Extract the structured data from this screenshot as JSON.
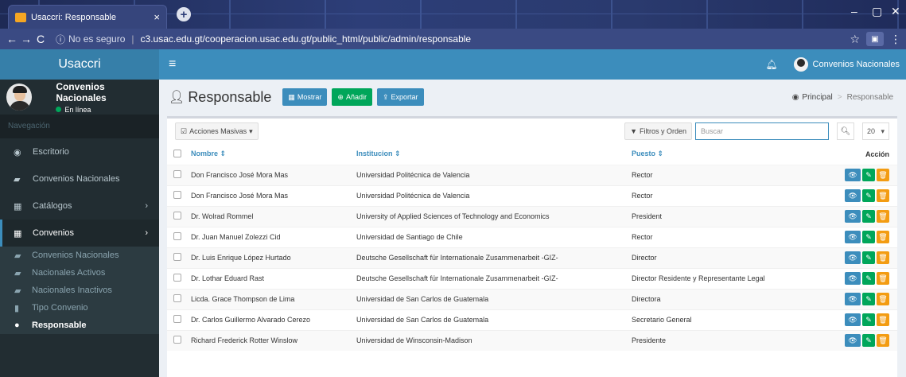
{
  "browser": {
    "tab_title": "Usaccri: Responsable",
    "tab_close": "×",
    "new_tab": "+",
    "insecure_label": "No es seguro",
    "url": "c3.usac.edu.gt/cooperacion.usac.edu.gt/public_html/public/admin/responsable",
    "icons": [
      "back-icon",
      "forward-icon",
      "reload-icon",
      "info-icon",
      "star-icon",
      "extension-icon",
      "menu-icon"
    ]
  },
  "header": {
    "logo": "Usaccri",
    "user_name": "Convenios Nacionales"
  },
  "sidebar": {
    "user": {
      "name": "Convenios Nacionales",
      "status": "En línea"
    },
    "nav_header": "Navegación",
    "items": [
      {
        "label": "Escritorio",
        "icon": "dashboard-icon"
      },
      {
        "label": "Convenios Nacionales",
        "icon": "book-icon"
      },
      {
        "label": "Catálogos",
        "icon": "table-icon"
      },
      {
        "label": "Convenios",
        "icon": "table-icon"
      }
    ],
    "subitems": [
      {
        "label": "Convenios Nacionales",
        "icon": "book-icon"
      },
      {
        "label": "Nacionales Activos",
        "icon": "book-icon"
      },
      {
        "label": "Nacionales Inactivos",
        "icon": "book-icon"
      },
      {
        "label": "Tipo Convenio",
        "icon": "bookmark-icon"
      },
      {
        "label": "Responsable",
        "icon": "user-icon"
      }
    ]
  },
  "content": {
    "title": "Responsable",
    "buttons": {
      "show": "Mostrar",
      "add": "Añadir",
      "export": "Exportar"
    },
    "breadcrumb": {
      "home": "Principal",
      "current": "Responsable"
    },
    "toolbar": {
      "bulk": "Acciones Masivas",
      "filters": "Filtros y Orden",
      "search_placeholder": "Buscar",
      "page_size": "20"
    },
    "table": {
      "headers": {
        "name": "Nombre",
        "institution": "Institucion",
        "position": "Puesto",
        "action": "Acción"
      },
      "rows": [
        {
          "name": "Don Francisco José Mora Mas",
          "institution": "Universidad Politécnica de Valencia",
          "position": "Rector"
        },
        {
          "name": "Don Francisco José Mora Mas",
          "institution": "Universidad Politécnica de Valencia",
          "position": "Rector"
        },
        {
          "name": "Dr. Wolrad Rommel",
          "institution": "University of Applied Sciences of Technology and Economics",
          "position": "President"
        },
        {
          "name": "Dr. Juan Manuel Zolezzi Cid",
          "institution": "Universidad de Santiago de Chile",
          "position": "Rector"
        },
        {
          "name": "Dr. Luis Enrique López Hurtado",
          "institution": "Deutsche Gesellschaft für Internationale Zusammenarbeit -GIZ-",
          "position": "Director"
        },
        {
          "name": "Dr. Lothar Eduard Rast",
          "institution": "Deutsche Gesellschaft für Internationale Zusammenarbeit -GIZ-",
          "position": "Director Residente y Representante Legal"
        },
        {
          "name": "Licda. Grace Thompson de Lima",
          "institution": "Universidad de San Carlos de Guatemala",
          "position": "Directora"
        },
        {
          "name": "Dr. Carlos Guillermo Alvarado Cerezo",
          "institution": "Universidad de San Carlos de Guatemala",
          "position": "Secretario General"
        },
        {
          "name": "Richard Frederick Rotter Winslow",
          "institution": "Universidad de Winsconsin-Madison",
          "position": "Presidente"
        }
      ]
    }
  },
  "colors": {
    "header": "#3c8dbc",
    "sidebar": "#222d32",
    "success": "#00a65a",
    "warning": "#f39c12"
  }
}
